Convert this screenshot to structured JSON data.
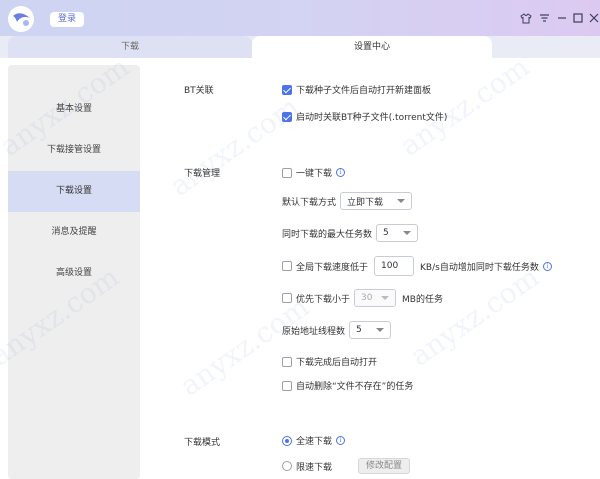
{
  "header": {
    "login_label": "登录"
  },
  "tabs": [
    {
      "label": "下载",
      "active": false
    },
    {
      "label": "设置中心",
      "active": true
    }
  ],
  "sidebar": {
    "items": [
      {
        "label": "基本设置"
      },
      {
        "label": "下载接管设置"
      },
      {
        "label": "下载设置",
        "active": true
      },
      {
        "label": "消息及提醒"
      },
      {
        "label": "高级设置"
      }
    ]
  },
  "bt": {
    "label": "BT关联",
    "opt1": "下载种子文件后自动打开新建面板",
    "opt2": "启动时关联BT种子文件(.torrent文件)"
  },
  "manage": {
    "label": "下载管理",
    "one_click": "一键下载",
    "default_mode_label": "默认下载方式",
    "default_mode_value": "立即下载",
    "max_tasks_label": "同时下载的最大任务数",
    "max_tasks_value": "5",
    "speed_prefix": "全局下载速度低于",
    "speed_value": "100",
    "speed_suffix": "KB/s自动增加同时下载任务数",
    "priority_prefix": "优先下载小于",
    "priority_value": "30",
    "priority_suffix": "MB的任务",
    "origin_threads_label": "原始地址线程数",
    "origin_threads_value": "5",
    "auto_open": "下载完成后自动打开",
    "auto_delete": "自动删除“文件不存在”的任务"
  },
  "mode": {
    "label": "下载模式",
    "full_speed": "全速下载",
    "limited": "限速下载",
    "config_button": "修改配置"
  },
  "watermark": "anyxz.com",
  "colors": {
    "accent": "#4d74e8",
    "sidebar_active": "#d6dcf3",
    "header_start": "#cdd4f2",
    "header_end": "#dcc9f1"
  }
}
